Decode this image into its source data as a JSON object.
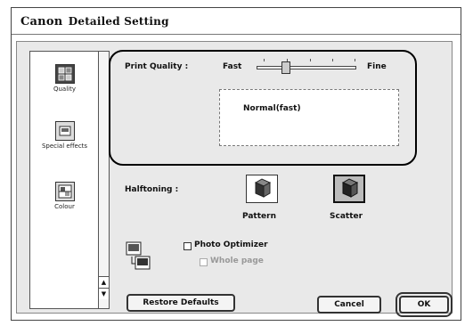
{
  "window": {
    "brand": "Canon",
    "title": "Detailed Setting"
  },
  "sidebar": {
    "items": [
      {
        "label": "Quality",
        "icon": "quality-icon",
        "selected": true
      },
      {
        "label": "Special effects",
        "icon": "special-effects-icon",
        "selected": false
      },
      {
        "label": "Colour",
        "icon": "colour-icon",
        "selected": false
      }
    ]
  },
  "print_quality": {
    "label": "Print Quality :",
    "min_label": "Fast",
    "max_label": "Fine",
    "current": "Normal(fast)"
  },
  "halftoning": {
    "label": "Halftoning :",
    "options": [
      {
        "label": "Pattern",
        "selected": false
      },
      {
        "label": "Scatter",
        "selected": true
      }
    ]
  },
  "photo_optimizer": {
    "label": "Photo Optimizer",
    "checked": false,
    "whole_page": {
      "label": "Whole page",
      "checked": false,
      "enabled": false
    }
  },
  "buttons": {
    "restore": "Restore Defaults",
    "cancel": "Cancel",
    "ok": "OK"
  }
}
